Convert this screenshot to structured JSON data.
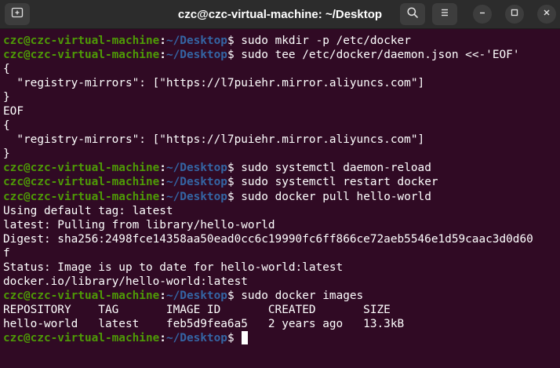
{
  "window": {
    "title": "czc@czc-virtual-machine: ~/Desktop"
  },
  "titlebar": {
    "new_tab_icon": "new-tab-icon",
    "search_icon": "search-icon",
    "menu_icon": "hamburger-menu-icon",
    "minimize_icon": "minimize-icon",
    "maximize_icon": "maximize-icon",
    "close_icon": "close-icon"
  },
  "prompt": {
    "user_host": "czc@czc-virtual-machine",
    "separator": ":",
    "path": "~/Desktop",
    "symbol": "$"
  },
  "colors": {
    "background": "#300a24",
    "prompt_user": "#4e9a06",
    "prompt_path": "#3465a4",
    "text": "#ffffff"
  },
  "lines": [
    {
      "type": "prompt",
      "text": " sudo mkdir -p /etc/docker"
    },
    {
      "type": "prompt",
      "text": " sudo tee /etc/docker/daemon.json <<-'EOF'"
    },
    {
      "type": "output",
      "text": "{"
    },
    {
      "type": "output",
      "text": "  \"registry-mirrors\": [\"https://l7puiehr.mirror.aliyuncs.com\"]"
    },
    {
      "type": "output",
      "text": "}"
    },
    {
      "type": "output",
      "text": "EOF"
    },
    {
      "type": "output",
      "text": "{"
    },
    {
      "type": "output",
      "text": "  \"registry-mirrors\": [\"https://l7puiehr.mirror.aliyuncs.com\"]"
    },
    {
      "type": "output",
      "text": "}"
    },
    {
      "type": "prompt",
      "text": " sudo systemctl daemon-reload"
    },
    {
      "type": "prompt",
      "text": " sudo systemctl restart docker"
    },
    {
      "type": "prompt",
      "text": " sudo docker pull hello-world"
    },
    {
      "type": "output",
      "text": "Using default tag: latest"
    },
    {
      "type": "output",
      "text": "latest: Pulling from library/hello-world"
    },
    {
      "type": "output",
      "text": "Digest: sha256:2498fce14358aa50ead0cc6c19990fc6ff866ce72aeb5546e1d59caac3d0d60"
    },
    {
      "type": "output",
      "text": "f"
    },
    {
      "type": "output",
      "text": "Status: Image is up to date for hello-world:latest"
    },
    {
      "type": "output",
      "text": "docker.io/library/hello-world:latest"
    },
    {
      "type": "prompt",
      "text": " sudo docker images"
    },
    {
      "type": "output",
      "text": "REPOSITORY    TAG       IMAGE ID       CREATED       SIZE"
    },
    {
      "type": "output",
      "text": "hello-world   latest    feb5d9fea6a5   2 years ago   13.3kB"
    },
    {
      "type": "prompt_cursor",
      "text": " "
    }
  ]
}
